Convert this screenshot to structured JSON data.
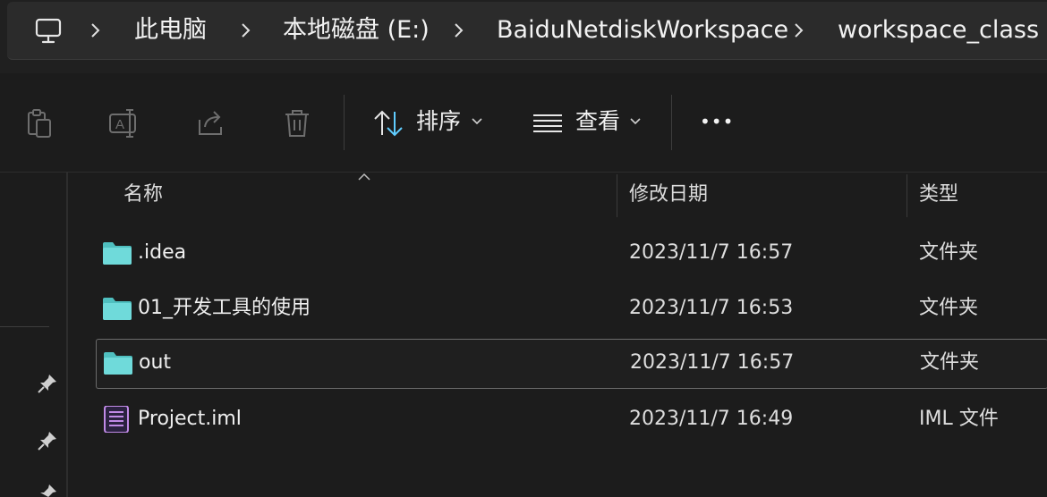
{
  "breadcrumb": {
    "items": [
      {
        "label": "此电脑"
      },
      {
        "label": "本地磁盘 (E:)"
      },
      {
        "label": "BaiduNetdiskWorkspace"
      },
      {
        "label": "workspace_class"
      }
    ]
  },
  "toolbar": {
    "sort_label": "排序",
    "view_label": "查看",
    "more_label": "•••"
  },
  "columns": {
    "name": "名称",
    "modified": "修改日期",
    "type": "类型"
  },
  "files": [
    {
      "name": ".idea",
      "modified": "2023/11/7 16:57",
      "type": "文件夹",
      "icon": "folder-icon"
    },
    {
      "name": "01_开发工具的使用",
      "modified": "2023/11/7 16:53",
      "type": "文件夹",
      "icon": "folder-icon"
    },
    {
      "name": "out",
      "modified": "2023/11/7 16:57",
      "type": "文件夹",
      "icon": "folder-icon",
      "selected": true
    },
    {
      "name": "Project.iml",
      "modified": "2023/11/7 16:49",
      "type": "IML 文件",
      "icon": "iml-file-icon"
    }
  ],
  "colors": {
    "folder": "#5fd3d3",
    "accent": "#60cdff",
    "file_icon": "#c08ae6"
  }
}
